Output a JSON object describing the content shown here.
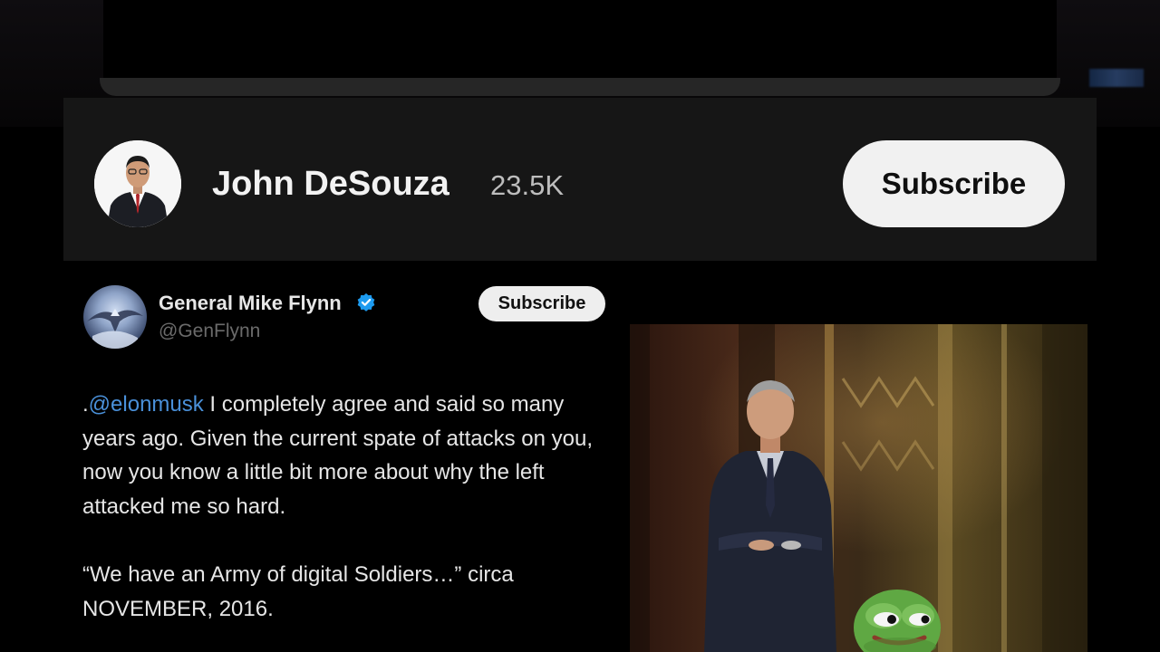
{
  "channel": {
    "name": "John DeSouza",
    "subscriber_count": "23.5K",
    "subscribe_label": "Subscribe"
  },
  "tweet": {
    "author_name": "General Mike Flynn",
    "author_handle": "@GenFlynn",
    "verified": true,
    "subscribe_label": "Subscribe",
    "mention_prefix": ".",
    "mention": "@elonmusk",
    "paragraph1_rest": " I completely agree and said so many years ago. Given the current spate of attacks on you, now you know a little bit more about why the left attacked me so hard.",
    "paragraph2": "“We have an Army of digital Soldiers…” circa NOVEMBER, 2016."
  },
  "colors": {
    "background": "#000000",
    "channel_bar": "#161616",
    "subscribe_button": "#f1f1f1",
    "mention_link": "#4a90d9",
    "verified_badge": "#1d9bf0"
  },
  "icons": {
    "verified": "verified-badge-icon"
  }
}
